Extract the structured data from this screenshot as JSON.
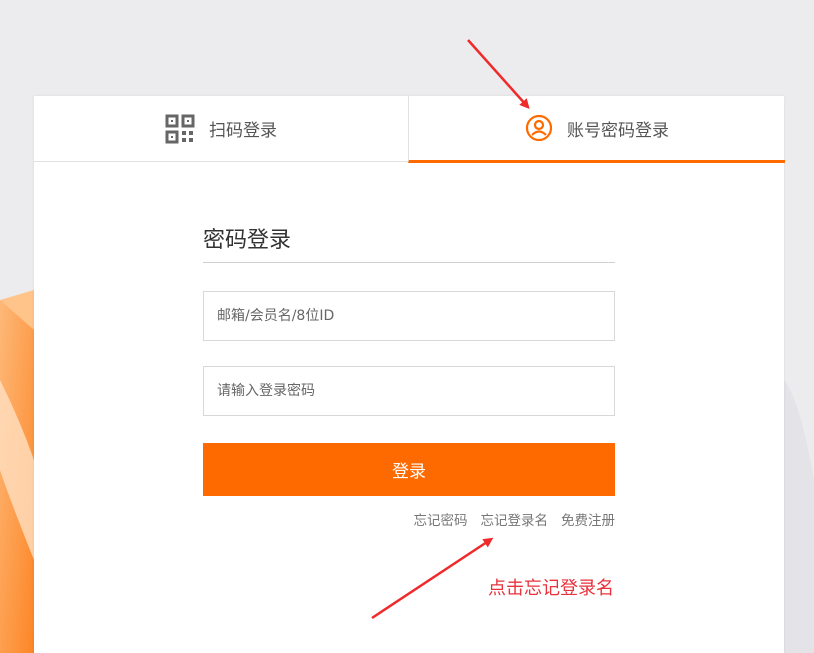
{
  "tabs": {
    "qr_label": "扫码登录",
    "account_label": "账号密码登录"
  },
  "form": {
    "title": "密码登录",
    "username_placeholder": "邮箱/会员名/8位ID",
    "password_placeholder": "请输入登录密码",
    "login_button": "登录"
  },
  "links": {
    "forgot_password": "忘记密码",
    "forgot_username": "忘记登录名",
    "register": "免费注册"
  },
  "annotation": {
    "text": "点击忘记登录名"
  },
  "colors": {
    "accent": "#ff6a00",
    "annotation": "#e8323c"
  },
  "icons": {
    "qr_tab": "qr-code-icon",
    "account_tab": "user-circle-icon"
  }
}
